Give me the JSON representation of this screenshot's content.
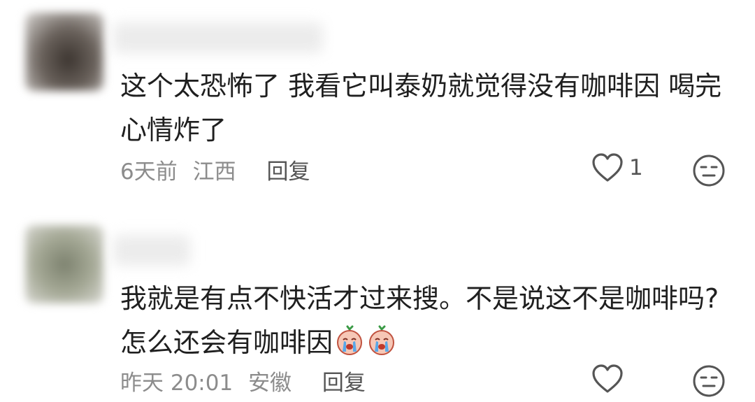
{
  "comments": [
    {
      "text_line1": "这个太恐怖了 我看它叫泰奶就觉得没有咖啡因 喝完",
      "text_line2": "心情炸了",
      "time": "6天前",
      "location": "江西",
      "reply_label": "回复",
      "like_count": "1",
      "avatar_color": "#5a5550"
    },
    {
      "text_line1": "我就是有点不快活才过来搜。不是说这不是咖啡吗?",
      "text_line2": "怎么还会有咖啡因",
      "emojis": [
        "crying-face-emoji",
        "crying-face-emoji"
      ],
      "time": "昨天 20:01",
      "location": "安徽",
      "reply_label": "回复",
      "like_count": "",
      "avatar_color": "#8f9382"
    }
  ],
  "colors": {
    "meta": "#8c8c8c",
    "text": "#1f1f1f",
    "icon": "#555555"
  }
}
